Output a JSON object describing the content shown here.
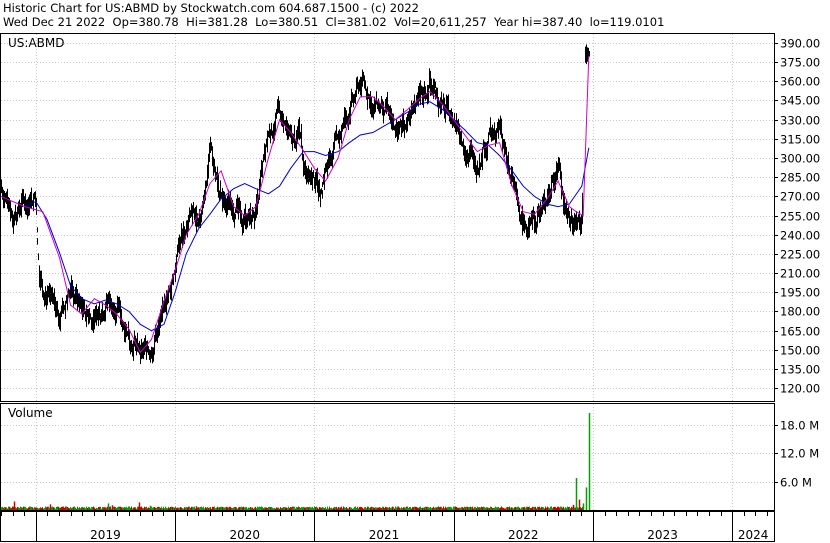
{
  "header": {
    "title": "Historic Chart for US:ABMD by Stockwatch.com 604.687.1500 - (c) 2022",
    "date": "Wed Dec 21 2022",
    "open": "Op=380.78",
    "high": "Hi=381.28",
    "low": "Lo=380.51",
    "close": "Cl=381.02",
    "volume": "Vol=20,611,257",
    "year_high": "Year hi=387.40",
    "year_low": "lo=119.0101"
  },
  "chart_data": {
    "type": "line",
    "price_panel_label": "US:ABMD",
    "volume_panel_label": "Volume",
    "x_tick_labels": [
      "2019",
      "2020",
      "2021",
      "2022",
      "2023",
      "2024"
    ],
    "price_ticks": [
      390,
      375,
      360,
      345,
      330,
      315,
      300,
      285,
      270,
      255,
      240,
      225,
      210,
      195,
      180,
      165,
      150,
      135,
      120
    ],
    "price_tick_labels": [
      "390.00",
      "375.00",
      "360.00",
      "345.00",
      "330.00",
      "315.00",
      "300.00",
      "285.00",
      "270.00",
      "255.00",
      "240.00",
      "225.00",
      "210.00",
      "195.00",
      "180.00",
      "165.00",
      "150.00",
      "135.00",
      "120.00"
    ],
    "ylim": [
      110,
      397
    ],
    "volume_ticks": [
      18,
      12,
      6
    ],
    "volume_tick_labels": [
      "18.0 M",
      "12.0 M",
      "6.0 M"
    ],
    "volume_ylim": [
      0,
      22.5
    ],
    "time_range": [
      2018.75,
      2024.3
    ],
    "price_series": {
      "x": [
        2018.75,
        2018.83,
        2018.92,
        2019.0,
        2019.02,
        2019.08,
        2019.17,
        2019.25,
        2019.33,
        2019.42,
        2019.5,
        2019.58,
        2019.67,
        2019.75,
        2019.83,
        2019.92,
        2019.97,
        2020.04,
        2020.13,
        2020.17,
        2020.21,
        2020.25,
        2020.33,
        2020.42,
        2020.5,
        2020.58,
        2020.67,
        2020.75,
        2020.83,
        2020.9,
        2020.92,
        2021.0,
        2021.04,
        2021.08,
        2021.17,
        2021.25,
        2021.33,
        2021.42,
        2021.5,
        2021.58,
        2021.67,
        2021.75,
        2021.83,
        2021.92,
        2022.0,
        2022.08,
        2022.17,
        2022.25,
        2022.33,
        2022.42,
        2022.5,
        2022.58,
        2022.67,
        2022.75,
        2022.78,
        2022.82,
        2022.87,
        2022.92,
        2022.97
      ],
      "y": [
        278,
        255,
        265,
        272,
        213,
        192,
        178,
        198,
        184,
        172,
        190,
        183,
        162,
        146,
        152,
        182,
        201,
        238,
        255,
        248,
        273,
        310,
        268,
        261,
        250,
        258,
        320,
        335,
        311,
        320,
        298,
        285,
        270,
        292,
        318,
        338,
        360,
        342,
        340,
        320,
        330,
        348,
        358,
        340,
        330,
        308,
        295,
        318,
        322,
        280,
        245,
        250,
        270,
        295,
        270,
        255,
        250,
        255,
        381
      ]
    },
    "ma_fast": {
      "x": [
        2018.75,
        2018.92,
        2019.05,
        2019.17,
        2019.25,
        2019.33,
        2019.42,
        2019.5,
        2019.58,
        2019.67,
        2019.75,
        2019.83,
        2019.92,
        2020.0,
        2020.08,
        2020.17,
        2020.25,
        2020.33,
        2020.42,
        2020.5,
        2020.58,
        2020.67,
        2020.75,
        2020.83,
        2020.92,
        2021.0,
        2021.08,
        2021.17,
        2021.25,
        2021.33,
        2021.42,
        2021.5,
        2021.58,
        2021.67,
        2021.75,
        2021.83,
        2021.92,
        2022.0,
        2022.08,
        2022.17,
        2022.25,
        2022.33,
        2022.42,
        2022.5,
        2022.58,
        2022.67,
        2022.75,
        2022.79,
        2022.83,
        2022.88,
        2022.93,
        2022.97
      ],
      "y": [
        270,
        262,
        258,
        222,
        185,
        178,
        190,
        185,
        178,
        166,
        148,
        158,
        188,
        212,
        240,
        256,
        280,
        290,
        262,
        255,
        262,
        300,
        330,
        320,
        306,
        292,
        282,
        300,
        330,
        348,
        348,
        340,
        330,
        338,
        346,
        352,
        342,
        330,
        318,
        305,
        310,
        312,
        278,
        258,
        256,
        268,
        282,
        272,
        262,
        258,
        255,
        380
      ]
    },
    "ma_slow": {
      "x": [
        2018.92,
        2019.0,
        2019.08,
        2019.17,
        2019.25,
        2019.33,
        2019.42,
        2019.5,
        2019.58,
        2019.67,
        2019.75,
        2019.83,
        2019.92,
        2020.0,
        2020.08,
        2020.17,
        2020.25,
        2020.33,
        2020.42,
        2020.5,
        2020.58,
        2020.67,
        2020.75,
        2020.83,
        2020.92,
        2021.0,
        2021.08,
        2021.17,
        2021.25,
        2021.33,
        2021.42,
        2021.5,
        2021.58,
        2021.67,
        2021.75,
        2021.83,
        2021.92,
        2022.0,
        2022.08,
        2022.17,
        2022.25,
        2022.33,
        2022.42,
        2022.5,
        2022.58,
        2022.67,
        2022.75,
        2022.83,
        2022.92,
        2022.97
      ],
      "y": [
        262,
        266,
        252,
        226,
        200,
        190,
        186,
        189,
        186,
        180,
        170,
        165,
        170,
        195,
        225,
        245,
        256,
        268,
        276,
        280,
        276,
        272,
        278,
        292,
        305,
        305,
        302,
        305,
        312,
        318,
        320,
        325,
        330,
        336,
        342,
        344,
        338,
        330,
        322,
        312,
        310,
        302,
        290,
        278,
        270,
        264,
        262,
        264,
        278,
        308
      ]
    },
    "volume_spikes": [
      {
        "x": 2018.84,
        "v": 1.8,
        "color": "red"
      },
      {
        "x": 2019.1,
        "v": 1.2,
        "color": "red"
      },
      {
        "x": 2019.52,
        "v": 1.4,
        "color": "green"
      },
      {
        "x": 2019.55,
        "v": 1.0,
        "color": "red"
      },
      {
        "x": 2019.74,
        "v": 1.6,
        "color": "red"
      },
      {
        "x": 2019.82,
        "v": 0.9,
        "color": "green"
      },
      {
        "x": 2020.15,
        "v": 0.8,
        "color": "red"
      },
      {
        "x": 2020.6,
        "v": 0.7,
        "color": "green"
      },
      {
        "x": 2021.45,
        "v": 0.5,
        "color": "red"
      },
      {
        "x": 2022.3,
        "v": 0.6,
        "color": "green"
      },
      {
        "x": 2022.52,
        "v": 0.7,
        "color": "green"
      },
      {
        "x": 2022.86,
        "v": 1.1,
        "color": "red"
      },
      {
        "x": 2022.88,
        "v": 6.8,
        "color": "green"
      },
      {
        "x": 2022.9,
        "v": 2.2,
        "color": "red"
      },
      {
        "x": 2022.93,
        "v": 1.4,
        "color": "green"
      },
      {
        "x": 2022.95,
        "v": 4.8,
        "color": "green"
      },
      {
        "x": 2022.97,
        "v": 20.6,
        "color": "green"
      }
    ],
    "colors": {
      "price": "#000000",
      "ma_fast": "#cc00cc",
      "ma_slow": "#0000cc",
      "volume_up": "#00a000",
      "volume_down": "#cc0000",
      "grid": "#c8c8c8",
      "axis": "#000000"
    },
    "grid": true
  }
}
